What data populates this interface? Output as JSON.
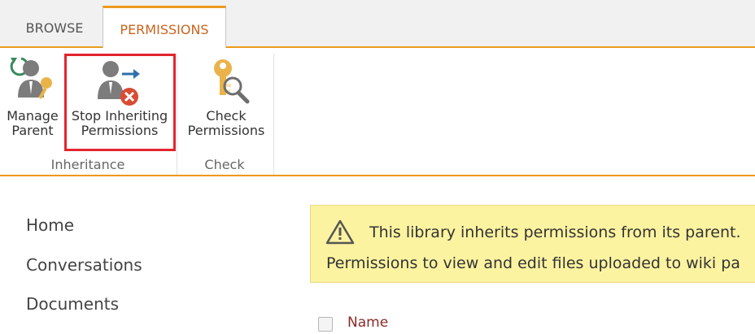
{
  "tabs": {
    "browse": "BROWSE",
    "permissions": "PERMISSIONS"
  },
  "ribbon": {
    "manage_parent": {
      "line1": "Manage",
      "line2": "Parent",
      "icon": "manage-parent-icon"
    },
    "stop_inheriting": {
      "line1": "Stop Inheriting",
      "line2": "Permissions",
      "icon": "stop-inheriting-icon"
    },
    "check_permissions": {
      "line1": "Check",
      "line2": "Permissions",
      "icon": "check-permissions-icon"
    },
    "groups": {
      "inheritance": "Inheritance",
      "check": "Check"
    }
  },
  "nav": {
    "items": [
      "Home",
      "Conversations",
      "Documents"
    ]
  },
  "warning": {
    "line1": "This library inherits permissions from its parent.",
    "line2": "Permissions to view and edit files uploaded to wiki pa",
    "icon": "warning-icon"
  },
  "list": {
    "name_header": "Name"
  },
  "colors": {
    "accent": "#ec9a1c",
    "highlight": "#e2252e",
    "warning_bg": "#fcf3a1"
  }
}
